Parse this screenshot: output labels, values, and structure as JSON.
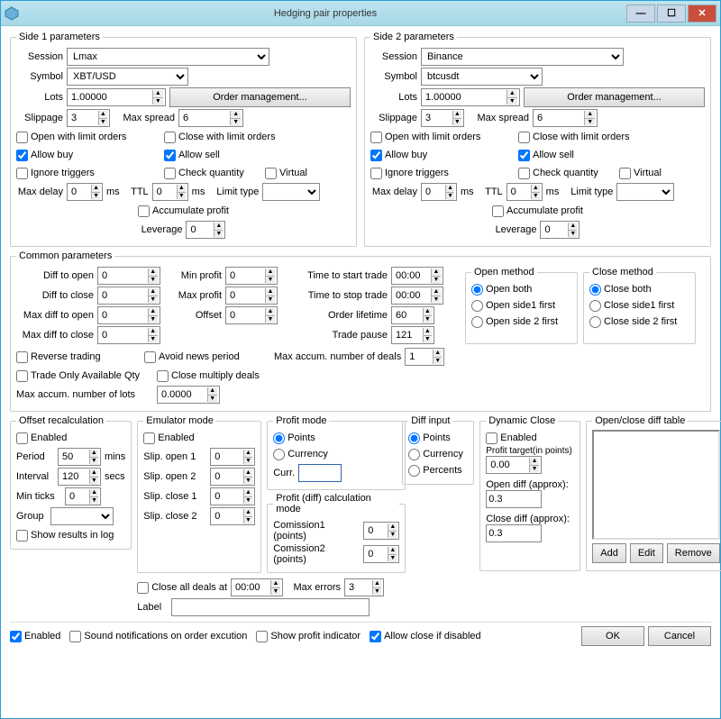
{
  "window": {
    "title": "Hedging pair properties",
    "min": "—",
    "max": "☐",
    "close": "✕"
  },
  "side1": {
    "legend": "Side 1 parameters",
    "session_lbl": "Session",
    "session": "Lmax",
    "symbol_lbl": "Symbol",
    "symbol": "XBT/USD",
    "lots_lbl": "Lots",
    "lots": "1.00000",
    "order_mgmt": "Order management...",
    "slippage_lbl": "Slippage",
    "slippage": "3",
    "max_spread_lbl": "Max spread",
    "max_spread": "6",
    "open_limit": "Open with limit orders",
    "close_limit": "Close with limit orders",
    "allow_buy": "Allow buy",
    "allow_sell": "Allow sell",
    "ignore_triggers": "Ignore triggers",
    "check_qty": "Check quantity",
    "virtual": "Virtual",
    "max_delay_lbl": "Max delay",
    "max_delay": "0",
    "ms1": "ms",
    "ttl_lbl": "TTL",
    "ttl": "0",
    "ms2": "ms",
    "limit_type_lbl": "Limit type",
    "limit_type": "",
    "accum_profit": "Accumulate profit",
    "leverage_lbl": "Leverage",
    "leverage": "0"
  },
  "side2": {
    "legend": "Side 2 parameters",
    "session_lbl": "Session",
    "session": "Binance",
    "symbol_lbl": "Symbol",
    "symbol": "btcusdt",
    "lots_lbl": "Lots",
    "lots": "1.00000",
    "order_mgmt": "Order management...",
    "slippage_lbl": "Slippage",
    "slippage": "3",
    "max_spread_lbl": "Max spread",
    "max_spread": "6",
    "open_limit": "Open with limit orders",
    "close_limit": "Close with limit orders",
    "allow_buy": "Allow buy",
    "allow_sell": "Allow sell",
    "ignore_triggers": "Ignore triggers",
    "check_qty": "Check quantity",
    "virtual": "Virtual",
    "max_delay_lbl": "Max delay",
    "max_delay": "0",
    "ms1": "ms",
    "ttl_lbl": "TTL",
    "ttl": "0",
    "ms2": "ms",
    "limit_type_lbl": "Limit type",
    "limit_type": "",
    "accum_profit": "Accumulate profit",
    "leverage_lbl": "Leverage",
    "leverage": "0"
  },
  "common": {
    "legend": "Common parameters",
    "diff_open_lbl": "Diff to open",
    "diff_open": "0",
    "diff_close_lbl": "Diff to close",
    "diff_close": "0",
    "max_diff_open_lbl": "Max diff to open",
    "max_diff_open": "0",
    "max_diff_close_lbl": "Max diff to close",
    "max_diff_close": "0",
    "min_profit_lbl": "Min profit",
    "min_profit": "0",
    "max_profit_lbl": "Max profit",
    "max_profit": "0",
    "offset_lbl": "Offset",
    "offset": "0",
    "time_start_lbl": "Time to start trade",
    "time_start": "00:00",
    "time_stop_lbl": "Time to stop trade",
    "time_stop": "00:00",
    "order_lifetime_lbl": "Order lifetime",
    "order_lifetime": "60",
    "trade_pause_lbl": "Trade pause",
    "trade_pause": "121",
    "open_method_lbl": "Open method",
    "open_both": "Open both",
    "open_s1": "Open side1 first",
    "open_s2": "Open side 2 first",
    "close_method_lbl": "Close method",
    "close_both": "Close both",
    "close_s1": "Close side1 first",
    "close_s2": "Close side 2 first",
    "reverse": "Reverse trading",
    "avoid_news": "Avoid news period",
    "max_deals_lbl": "Max accum. number of deals",
    "max_deals": "1",
    "trade_only": "Trade Only Available Qty",
    "close_mult": "Close multiply deals",
    "max_lots_lbl": "Max accum. number of lots",
    "max_lots": "0.0000"
  },
  "offset": {
    "legend": "Offset recalculation",
    "enabled": "Enabled",
    "period_lbl": "Period",
    "period": "50",
    "mins": "mins",
    "interval_lbl": "Interval",
    "interval": "120",
    "secs": "secs",
    "min_ticks_lbl": "Min ticks",
    "min_ticks": "0",
    "group_lbl": "Group",
    "show_results": "Show results in log"
  },
  "emulator": {
    "legend": "Emulator mode",
    "enabled": "Enabled",
    "so1_lbl": "Slip. open 1",
    "so1": "0",
    "so2_lbl": "Slip. open 2",
    "so2": "0",
    "sc1_lbl": "Slip. close 1",
    "sc1": "0",
    "sc2_lbl": "Slip. close 2",
    "sc2": "0",
    "close_all_lbl": "Close all deals at",
    "close_all_time": "00:00",
    "max_errors_lbl": "Max errors",
    "max_errors": "3",
    "label_lbl": "Label",
    "label_val": ""
  },
  "profit_mode": {
    "legend": "Profit mode",
    "points": "Points",
    "currency": "Currency",
    "curr_lbl": "Curr.",
    "curr_val": ""
  },
  "diff_input": {
    "legend": "Diff input",
    "points": "Points",
    "currency": "Currency",
    "percents": "Percents"
  },
  "profit_calc": {
    "legend": "Profit (diff) calculation mode",
    "c1_lbl": "Comission1 (points)",
    "c1": "0",
    "c2_lbl": "Comission2 (points)",
    "c2": "0"
  },
  "dynamic": {
    "legend": "Dynamic Close",
    "enabled": "Enabled",
    "target_lbl": "Profit target(in points)",
    "target": "0.00",
    "od_lbl": "Open diff (approx):",
    "od": "0.3",
    "cd_lbl": "Close diff (approx):",
    "cd": "0.3"
  },
  "oc_table": {
    "legend": "Open/close diff table",
    "add": "Add",
    "edit": "Edit",
    "remove": "Remove"
  },
  "bottom": {
    "enabled": "Enabled",
    "sound": "Sound notifications on order excution",
    "show_profit": "Show profit indicator",
    "allow_close": "Allow close if disabled",
    "ok": "OK",
    "cancel": "Cancel"
  }
}
